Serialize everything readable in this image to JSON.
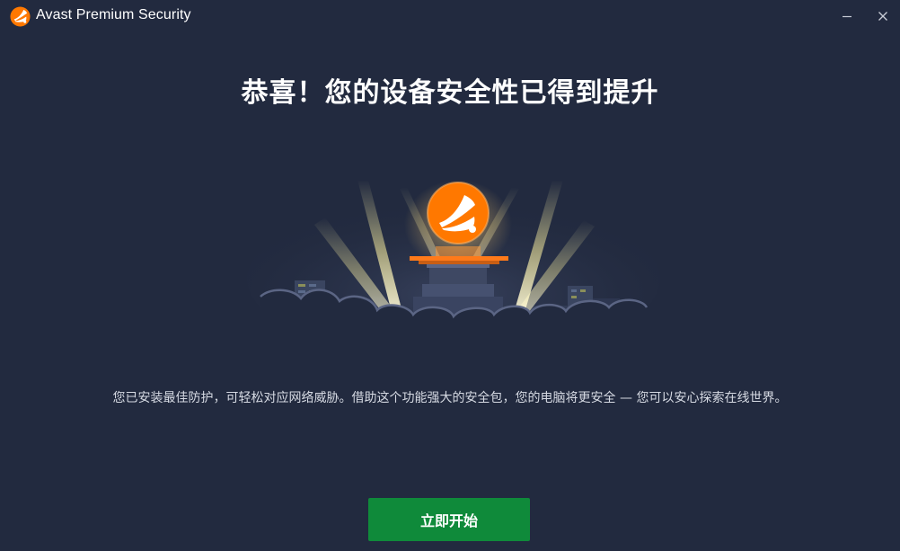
{
  "window": {
    "title": "Avast Premium Security",
    "controls": {
      "minimize": "minimize-icon",
      "close": "close-icon"
    }
  },
  "main": {
    "headline": "恭喜！您的设备安全性已得到提升",
    "description": "您已安装最佳防护，可轻松对应网络威胁。借助这个功能强大的安全包，您的电脑将更安全 — 您可以安心探索在线世界。",
    "primary_button": "立即开始"
  },
  "colors": {
    "background": "#222a3f",
    "brand_orange": "#ff7800",
    "button_green": "#0f8a3a"
  }
}
